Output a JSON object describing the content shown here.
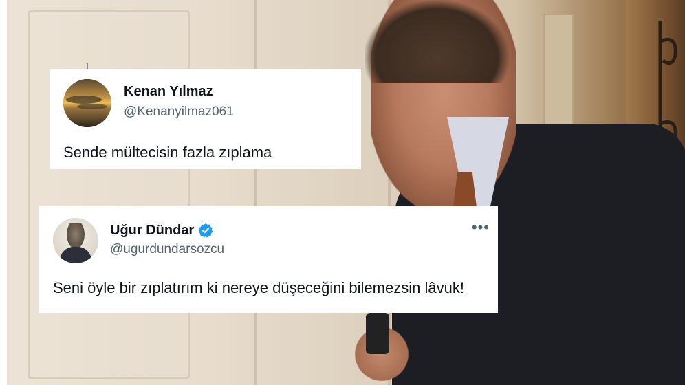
{
  "tweets": [
    {
      "name": "Kenan Yılmaz",
      "handle": "@Kenanyilmaz061",
      "text": "Sende mültecisin fazla zıplama",
      "avatar_icon": "sunset-avatar",
      "verified": false
    },
    {
      "name": "Uğur Dündar",
      "handle": "@ugurdundarsozcu",
      "text": "Seni öyle bir zıplatırım ki nereye düşeceğini bilemezsin lâvuk!",
      "avatar_icon": "portrait-avatar",
      "verified": true,
      "more_icon": "more-options-icon"
    }
  ],
  "colors": {
    "verified_badge": "#1d9bf0",
    "handle_text": "#536471",
    "primary_text": "#0f1419"
  }
}
